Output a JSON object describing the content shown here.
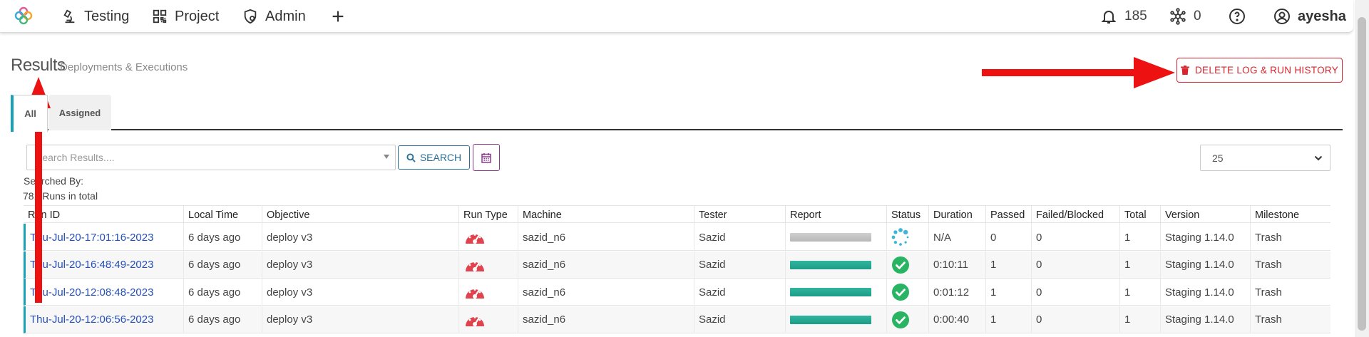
{
  "nav": {
    "items": [
      {
        "label": "Testing",
        "icon": "microscope-icon"
      },
      {
        "label": "Project",
        "icon": "qr-grid-icon"
      },
      {
        "label": "Admin",
        "icon": "shield-gear-icon"
      }
    ],
    "add_icon": "plus-icon",
    "notifications_count": "185",
    "network_count": "0",
    "username": "ayesha"
  },
  "header": {
    "title": "Results",
    "subtitle": "Deployments & Executions",
    "delete_button_label": "DELETE LOG & RUN HISTORY"
  },
  "tabs": [
    {
      "label": "All",
      "active": true
    },
    {
      "label": "Assigned",
      "active": false
    }
  ],
  "search": {
    "placeholder": "Search Results....",
    "button_label": "SEARCH",
    "page_size": "25",
    "searched_by_label": "Searched By:",
    "runs_total_label": "781 Runs in total"
  },
  "table": {
    "columns": [
      "Run ID",
      "Local Time",
      "Objective",
      "Run Type",
      "Machine",
      "Tester",
      "Report",
      "Status",
      "Duration",
      "Passed",
      "Failed/Blocked",
      "Total",
      "Version",
      "Milestone"
    ],
    "rows": [
      {
        "run_id": "Thu-Jul-20-17:01:16-2023",
        "local_time": "6 days ago",
        "objective": "deploy v3",
        "machine": "sazid_n6",
        "tester": "Sazid",
        "report": "in-progress",
        "status": "running",
        "duration": "N/A",
        "passed": "0",
        "failed": "0",
        "total": "1",
        "version": "Staging 1.14.0",
        "milestone": "Trash"
      },
      {
        "run_id": "Thu-Jul-20-16:48:49-2023",
        "local_time": "6 days ago",
        "objective": "deploy v3",
        "machine": "sazid_n6",
        "tester": "Sazid",
        "report": "passed",
        "status": "passed",
        "duration": "0:10:11",
        "passed": "1",
        "failed": "0",
        "total": "1",
        "version": "Staging 1.14.0",
        "milestone": "Trash"
      },
      {
        "run_id": "Thu-Jul-20-12:08:48-2023",
        "local_time": "6 days ago",
        "objective": "deploy v3",
        "machine": "sazid_n6",
        "tester": "Sazid",
        "report": "passed",
        "status": "passed",
        "duration": "0:01:12",
        "passed": "1",
        "failed": "0",
        "total": "1",
        "version": "Staging 1.14.0",
        "milestone": "Trash"
      },
      {
        "run_id": "Thu-Jul-20-12:06:56-2023",
        "local_time": "6 days ago",
        "objective": "deploy v3",
        "machine": "sazid_n6",
        "tester": "Sazid",
        "report": "passed",
        "status": "passed",
        "duration": "0:00:40",
        "passed": "1",
        "failed": "0",
        "total": "1",
        "version": "Staging 1.14.0",
        "milestone": "Trash"
      }
    ]
  },
  "colors": {
    "accent": "#17a2b8",
    "danger": "#d9252f",
    "link": "#2650b8",
    "success": "#28b463",
    "annotation": "#ee1111"
  }
}
